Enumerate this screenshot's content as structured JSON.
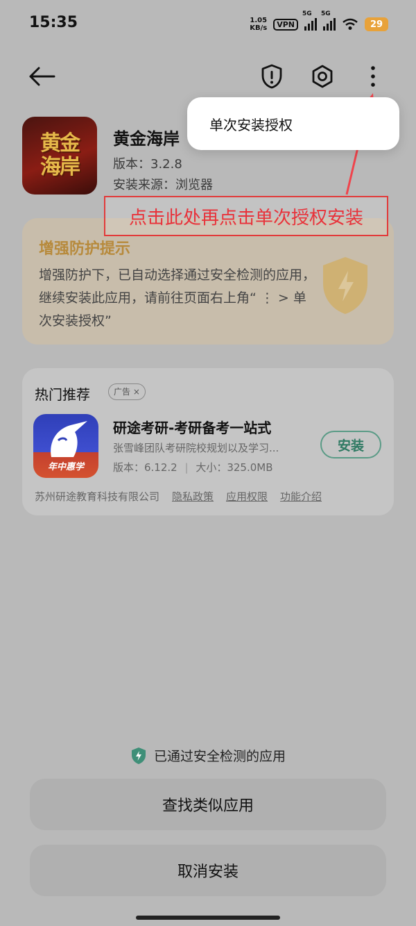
{
  "status": {
    "time": "15:35",
    "speed_value": "1.05",
    "speed_unit": "KB/s",
    "vpn": "VPN",
    "net1": "5G",
    "net2": "5G",
    "battery": "29"
  },
  "header": {
    "back_icon": "arrow-left-icon",
    "report_icon": "exclamation-shield-icon",
    "settings_icon": "hexagon-gear-icon",
    "more_icon": "more-vertical-icon"
  },
  "menu": {
    "item": "单次安装授权"
  },
  "app": {
    "name": "黄金海岸",
    "icon_text_line1": "黄金",
    "icon_text_line2": "海岸",
    "version": "版本：3.2.8",
    "source": "安装来源：浏览器"
  },
  "annotation": {
    "text": "点击此处再点击单次授权安装",
    "color": "#e8323a"
  },
  "warning": {
    "title": "增强防护提示",
    "body": "增强防护下，已自动选择通过安全检测的应用，继续安装此应用，请前往页面右上角“ ⋮ > 单次安装授权”"
  },
  "recommend": {
    "title": "热门推荐",
    "ad_label": "广告 ×",
    "app_name": "研途考研-考研备考一站式",
    "description": "张雪峰团队考研院校规划以及学习...",
    "version": "版本：6.12.2",
    "size": "大小：325.0MB",
    "icon_banner": "年中惠学",
    "install_label": "安装",
    "developer": "苏州研途教育科技有限公司",
    "links": [
      "隐私政策",
      "应用权限",
      "功能介绍"
    ]
  },
  "bottom": {
    "passed_text": "已通过安全检测的应用",
    "find_similar": "查找类似应用",
    "cancel_install": "取消安装"
  },
  "colors": {
    "overlay_bg": "#b9b9b9",
    "accent_green": "#2f7a63",
    "warning_gold": "#b78a3c",
    "battery": "#e8a23a"
  }
}
